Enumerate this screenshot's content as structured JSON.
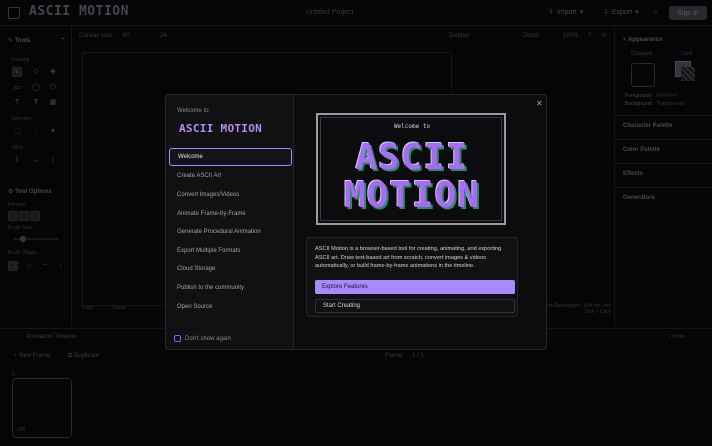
{
  "app": {
    "logo_text": "ASCII MOTION",
    "project_title": "Untitled Project",
    "import_label": "Import",
    "export_label": "Export",
    "signin_label": "Sign in"
  },
  "left_panel": {
    "tools_title": "Tools",
    "drawing_label": "Drawing",
    "selection_label": "Selection",
    "utility_label": "Utility",
    "tool_options_title": "Tool Options",
    "primary_label": "Primary",
    "brush_size_label": "Brush Size",
    "brush_shape_label": "Brush Shape"
  },
  "canvas": {
    "size_label": "Canvas size:",
    "width": "80",
    "height": "24",
    "display_label": "Display:",
    "zoom_label": "Zoom:",
    "zoom_value": "100%",
    "copy_label": "Copy",
    "paste_label": "Paste",
    "hint_line1": "Alt for Eyedropper, Shift for Line",
    "hint_line2": "Shift + Click"
  },
  "right_panel": {
    "appearance_title": "Appearance",
    "character_label": "Character",
    "color_label": "Color",
    "foreground_label": "Foreground",
    "foreground_value": "#FFFFFF",
    "background_label": "Background",
    "background_value": "Transparent",
    "character_palette_title": "Character Palette",
    "color_palette_title": "Color Palette",
    "effects_title": "Effects",
    "generators_title": "Generators"
  },
  "timeline": {
    "title": "Animation Timeline",
    "new_frame_label": "New Frame",
    "duplicate_label": "Duplicate",
    "frame_label": "Frame",
    "frame_value": "1 / 1",
    "frames_count": "1 frame",
    "thumb_index": "1",
    "thumb_duration": "100"
  },
  "modal": {
    "welcome_to": "Welcome to",
    "logo_text": "ASCII MOTION",
    "hero_welcome": "Welcome to",
    "hero_line1": "ASCII",
    "hero_line2": "MOTION",
    "menu": [
      "Welcome",
      "Create ASCII Art",
      "Convert Images/Videos",
      "Animate Frame-by-Frame",
      "Generate Procedural Animation",
      "Export Multiple Formats",
      "Cloud Storage",
      "Publish to the community",
      "Open Source"
    ],
    "dont_show_label": "Don't show again",
    "description": "ASCII Motion is a browser-based tool for creating, animating, and exporting ASCII art. Draw text-based art from scratch, convert images & videos automatically, or build frame-by-frame animations in the timeline.",
    "explore_label": "Explore Features",
    "start_label": "Start Creating"
  },
  "colors": {
    "accent": "#a78bfa",
    "logo_purple": "#b68cf0",
    "hero_green": "#2f8a66"
  }
}
